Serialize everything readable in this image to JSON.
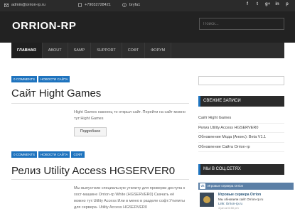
{
  "topbar": {
    "email": "admin@orrion-rp.ru",
    "phone": "+79032728421",
    "skype": "bryfa1",
    "socials": [
      "f",
      "t",
      "g+",
      "in",
      "p"
    ],
    "social_icons": [
      "facebook-icon",
      "twitter-icon",
      "google-plus-icon",
      "linkedin-icon",
      "pinterest-icon"
    ]
  },
  "header": {
    "logo": "ORRION-RP",
    "search_placeholder": "Поиск..."
  },
  "nav": {
    "items": [
      "ГЛАВНАЯ",
      "ABOUT",
      "SAMP",
      "SUPPORT",
      "СОФТ",
      "ФОРУМ"
    ],
    "active": "ГЛАВНАЯ"
  },
  "posts": [
    {
      "tags": [
        "0 COMMENTS",
        "НОВОСТИ САЙТА"
      ],
      "title": "Сайт Hight Games",
      "excerpt": "Hight Games наконец то открыл сайт. Перейти на сайт можно тут:Hight Games",
      "more": "Подробнее"
    },
    {
      "tags": [
        "0 COMMENTS",
        "НОВОСТИ САЙТА",
        "СОФТ"
      ],
      "title": "Релиз Utility Access HGSERVER0",
      "excerpt": "Мы выпустили специальную утилиту для проверки доступа к хост-машине Orrion-rp White (HGSERVER0) Скачать её можно тут:Utility Access Или в меню в разделе софт:Утилиты для сервера- Utility Access HGSERVER0"
    }
  ],
  "sidebar": {
    "search_placeholder": "",
    "recent_title": "СВЕЖИЕ ЗАПИСИ",
    "recent": [
      "Сайт Hight Games",
      "Релиз Utility Access HGSERVER0",
      "Обновление Мода (Анонс): Beta V1.1",
      "Обновление Сайта Orrion-rp"
    ],
    "social_title": "МЫ В СОЦ.СЕТЯХ",
    "vk": {
      "bar_title": "Игровые сервера Orrion",
      "name": "Игровые сервера Orrion",
      "text": "Мы обновили сайт Orrion-rp.ru",
      "link": "Link: Orrion-rp.ru",
      "time": "4 jan at 6:50 pm"
    }
  },
  "colors": {
    "accent": "#1e73be",
    "dark": "#222222",
    "topbar": "#2b2b2b"
  }
}
